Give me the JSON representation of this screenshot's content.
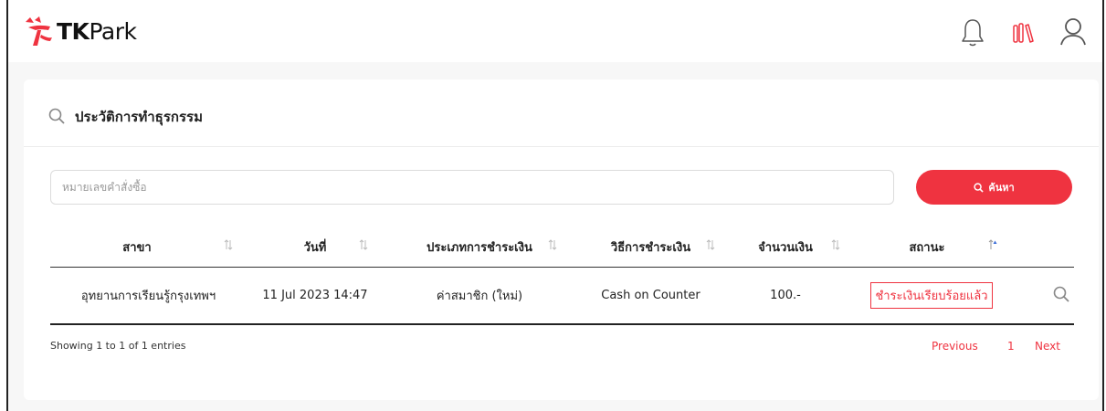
{
  "app": {
    "brand_prefix": "TK",
    "brand_suffix": "Park"
  },
  "header_icons": [
    "bell-icon",
    "books-icon",
    "user-icon"
  ],
  "card": {
    "title": "ประวัติการทำธุรกรรม"
  },
  "search": {
    "placeholder": "หมายเลขคำสั่งซื้อ",
    "button_label": "ค้นหา"
  },
  "table": {
    "headers": [
      "สาขา",
      "วันที่",
      "ประเภทการชำระเงิน",
      "วิธีการชำระเงิน",
      "จำนวนเงิน",
      "สถานะ"
    ],
    "rows": [
      {
        "branch": "อุทยานการเรียนรู้กรุงเทพฯ",
        "date": "11 Jul 2023 14:47",
        "payment_type": "ค่าสมาชิก (ใหม่)",
        "payment_method": "Cash on Counter",
        "amount": "100.-",
        "status": "ชำระเงินเรียบร้อยแล้ว"
      }
    ]
  },
  "pagination": {
    "info": "Showing 1 to 1 of 1 entries",
    "previous": "Previous",
    "page": "1",
    "next": "Next"
  },
  "colors": {
    "accent": "#ef3340",
    "page_bg": "#f7f7f7",
    "card_bg": "#ffffff"
  }
}
